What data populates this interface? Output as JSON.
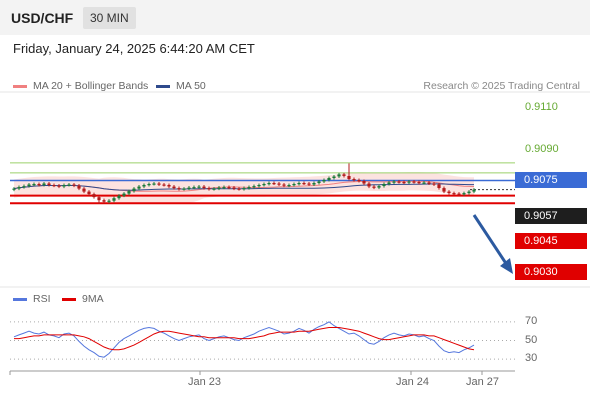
{
  "header": {
    "symbol": "USD/CHF",
    "timeframe": "30 MIN"
  },
  "datetime": "Friday, January 24, 2025 6:44:20 AM CET",
  "legend": {
    "bollinger": {
      "label": "MA 20 + Bollinger Bands",
      "color": "#f08080"
    },
    "ma50": {
      "label": "MA 50",
      "color": "#2f4a8c"
    },
    "source": "Research © 2025 Trading Central"
  },
  "levels": {
    "resistance_2": "0.9110",
    "resistance_1": "0.9090",
    "pivot": "0.9075",
    "last": "0.9057",
    "support_1": "0.9045",
    "support_2": "0.9030"
  },
  "colors": {
    "up": "#1b7a3a",
    "down": "#b21b1b",
    "pivot": "#3a6bd5",
    "support": "#e00000",
    "resistance": "#66aa33"
  },
  "rsi": {
    "label": "RSI",
    "ma_label": "9MA",
    "levels": [
      "70",
      "50",
      "30"
    ],
    "colors": {
      "rsi": "#5577dd",
      "ma": "#e00000"
    }
  },
  "xaxis": [
    "Jan 23",
    "Jan 24",
    "Jan 27"
  ],
  "chart_data": {
    "type": "candlestick",
    "ylim": [
      0.9025,
      0.9115
    ],
    "support_levels": [
      0.9045,
      0.903
    ],
    "resistance_levels": [
      0.909,
      0.911
    ],
    "pivot": 0.9075,
    "last_price": 0.9057,
    "forecast": "down",
    "closes": [
      0.9059,
      0.9062,
      0.9064,
      0.9067,
      0.9068,
      0.9066,
      0.9069,
      0.9066,
      0.9065,
      0.9063,
      0.9066,
      0.9067,
      0.9065,
      0.9059,
      0.9053,
      0.9048,
      0.9042,
      0.9036,
      0.9033,
      0.9035,
      0.904,
      0.9045,
      0.9049,
      0.9054,
      0.9059,
      0.9063,
      0.9066,
      0.9068,
      0.9069,
      0.9067,
      0.9066,
      0.9063,
      0.906,
      0.9058,
      0.9059,
      0.9061,
      0.9062,
      0.9063,
      0.906,
      0.9058,
      0.9059,
      0.9061,
      0.9062,
      0.9061,
      0.9059,
      0.9058,
      0.906,
      0.9062,
      0.9064,
      0.9066,
      0.9068,
      0.907,
      0.9069,
      0.9067,
      0.9065,
      0.9066,
      0.9068,
      0.907,
      0.9069,
      0.9067,
      0.907,
      0.9073,
      0.9076,
      0.908,
      0.9083,
      0.9087,
      0.9084,
      0.9078,
      0.9076,
      0.9074,
      0.9069,
      0.9063,
      0.9061,
      0.9064,
      0.9068,
      0.9071,
      0.9073,
      0.9072,
      0.9071,
      0.9073,
      0.9072,
      0.907,
      0.9071,
      0.9069,
      0.9067,
      0.906,
      0.9053,
      0.905,
      0.9049,
      0.9048,
      0.905,
      0.9053,
      0.9057
    ],
    "rsi": [
      54,
      56,
      58,
      60,
      58,
      57,
      59,
      56,
      55,
      53,
      57,
      58,
      55,
      49,
      44,
      40,
      37,
      33,
      32,
      36,
      42,
      48,
      52,
      55,
      58,
      61,
      63,
      64,
      63,
      60,
      58,
      55,
      52,
      50,
      52,
      54,
      55,
      56,
      52,
      50,
      52,
      54,
      55,
      53,
      51,
      50,
      53,
      55,
      57,
      60,
      62,
      64,
      62,
      60,
      57,
      58,
      60,
      63,
      61,
      58,
      62,
      65,
      67,
      70,
      66,
      63,
      60,
      57,
      58,
      55,
      51,
      47,
      46,
      49,
      53,
      56,
      58,
      56,
      55,
      57,
      56,
      54,
      55,
      52,
      50,
      44,
      39,
      37,
      38,
      37,
      40,
      42,
      45
    ],
    "rsi_ma": [
      52,
      52,
      53,
      54,
      55,
      55,
      56,
      56,
      56,
      56,
      56,
      56,
      56,
      55,
      54,
      52,
      49,
      46,
      43,
      41,
      40,
      40,
      41,
      43,
      45,
      48,
      51,
      54,
      57,
      59,
      60,
      60,
      59,
      58,
      57,
      56,
      55,
      54,
      54,
      53,
      53,
      53,
      53,
      53,
      53,
      52,
      52,
      52,
      53,
      54,
      55,
      57,
      58,
      59,
      59,
      59,
      59,
      60,
      60,
      60,
      61,
      62,
      63,
      64,
      64,
      64,
      63,
      62,
      61,
      60,
      58,
      56,
      54,
      52,
      51,
      51,
      52,
      53,
      54,
      55,
      56,
      56,
      56,
      55,
      55,
      53,
      51,
      49,
      47,
      45,
      43,
      41,
      40
    ]
  }
}
